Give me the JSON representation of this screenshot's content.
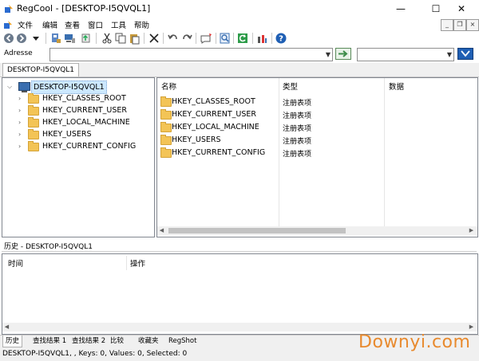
{
  "window": {
    "title": "RegCool - [DESKTOP-I5QVQL1]",
    "minimize": "—",
    "maximize": "☐",
    "close": "✕"
  },
  "menu": [
    "文件",
    "编辑",
    "查看",
    "窗口",
    "工具",
    "帮助"
  ],
  "address": {
    "label": "Adresse",
    "value": "",
    "search_value": ""
  },
  "top_tab": "DESKTOP-I5QVQL1",
  "tree": {
    "root": "DESKTOP-I5QVQL1",
    "children": [
      "HKEY_CLASSES_ROOT",
      "HKEY_CURRENT_USER",
      "HKEY_LOCAL_MACHINE",
      "HKEY_USERS",
      "HKEY_CURRENT_CONFIG"
    ]
  },
  "list": {
    "columns": [
      "名称",
      "类型",
      "数据"
    ],
    "rows": [
      {
        "name": "HKEY_CLASSES_ROOT",
        "type": "注册表项"
      },
      {
        "name": "HKEY_CURRENT_USER",
        "type": "注册表项"
      },
      {
        "name": "HKEY_LOCAL_MACHINE",
        "type": "注册表项"
      },
      {
        "name": "HKEY_USERS",
        "type": "注册表项"
      },
      {
        "name": "HKEY_CURRENT_CONFIG",
        "type": "注册表项"
      }
    ]
  },
  "history": {
    "title": "历史 - DESKTOP-I5QVQL1",
    "columns": [
      "时间",
      "操作"
    ]
  },
  "bottom_tabs": [
    "历史",
    "查找结果 1",
    "查找结果 2",
    "比较",
    "收藏夹",
    "RegShot"
  ],
  "status": "DESKTOP-I5QVQL1, , Keys: 0, Values: 0, Selected: 0",
  "watermark": "Downyi.com",
  "colors": {
    "selection": "#cce8ff",
    "folder": "#f3c456",
    "watermark": "#e88a2e",
    "go_button": "#3d8c4a",
    "find_button": "#1f5fb4"
  },
  "icons": [
    "back-icon",
    "forward-icon",
    "dropdown-icon",
    "connect-icon",
    "computer-icon",
    "export-icon",
    "cut-icon",
    "copy-icon",
    "paste-icon",
    "delete-icon",
    "undo-icon",
    "redo-icon",
    "find-icon",
    "bookmark-icon",
    "refresh-icon",
    "tools-icon",
    "help-icon"
  ]
}
